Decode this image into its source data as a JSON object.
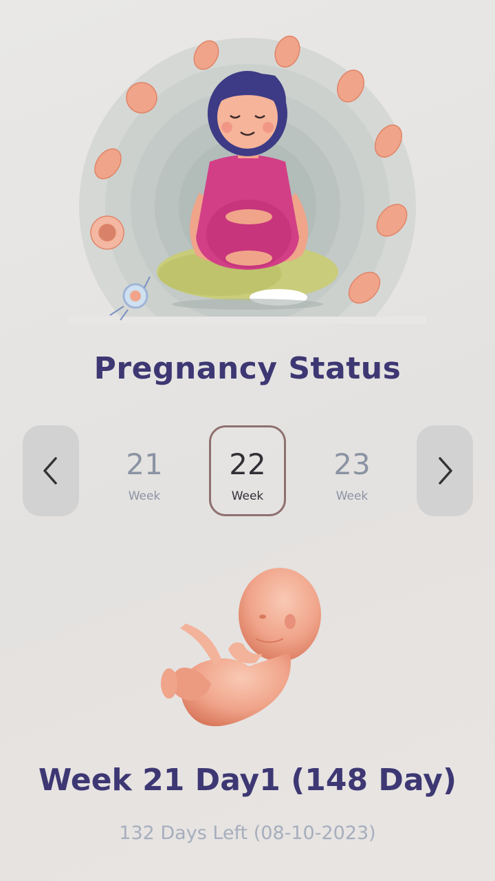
{
  "header": {
    "title": "Pregnancy Status"
  },
  "week_selector": {
    "prev_icon": "chevron-left-icon",
    "next_icon": "chevron-right-icon",
    "weeks": [
      {
        "number": "21",
        "label": "Week"
      },
      {
        "number": "22",
        "label": "Week",
        "selected": true
      },
      {
        "number": "23",
        "label": "Week"
      }
    ]
  },
  "status": {
    "week_day": "Week 21 Day1 (148 Day)",
    "days_left": "132 Days Left (08-10-2023)"
  },
  "colors": {
    "title": "#3d3873",
    "muted": "#a6aebd",
    "selected_border": "#8e7070",
    "nav_button": "#d2d2d2",
    "fetus": "#f0a48a"
  }
}
